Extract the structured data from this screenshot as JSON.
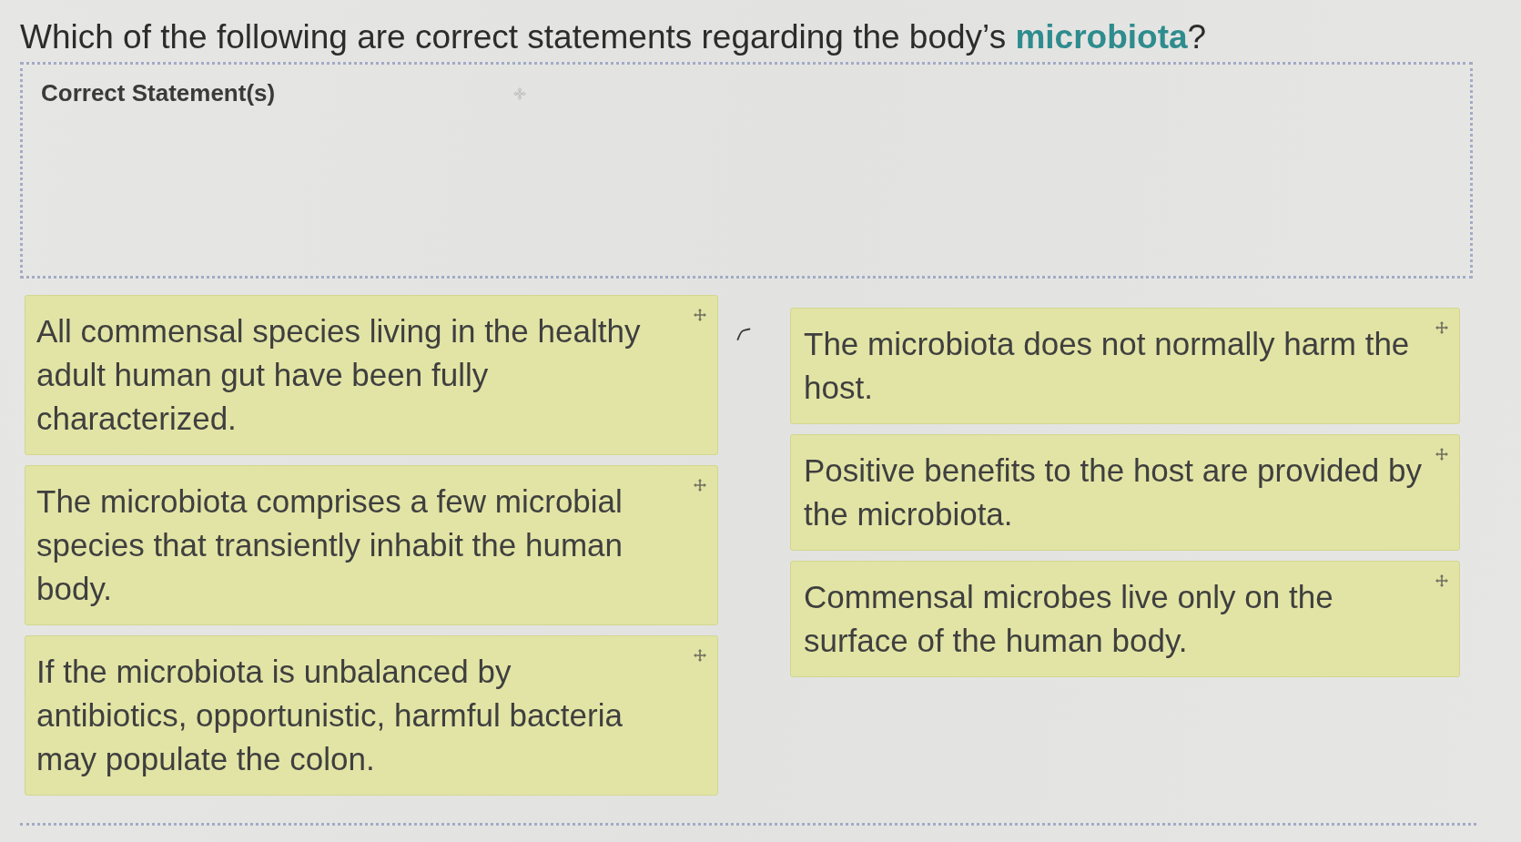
{
  "question": {
    "text": "Which of the following are correct statements regarding the body’s **microbiota**?"
  },
  "drop_zone": {
    "label": "Correct Statement(s)"
  },
  "columns": [
    {
      "cards": [
        "All commensal species living in the healthy adult human gut have been fully characterized.",
        "The microbiota comprises a few microbial species that transiently inhabit the human body.",
        "If the microbiota is unbalanced by antibiotics, opportunistic, harmful bacteria may populate the colon."
      ]
    },
    {
      "cards": [
        "The microbiota does not normally harm the host.",
        "Positive benefits to the host are provided by the microbiota.",
        "Commensal microbes live only on the surface of the human body."
      ]
    }
  ]
}
